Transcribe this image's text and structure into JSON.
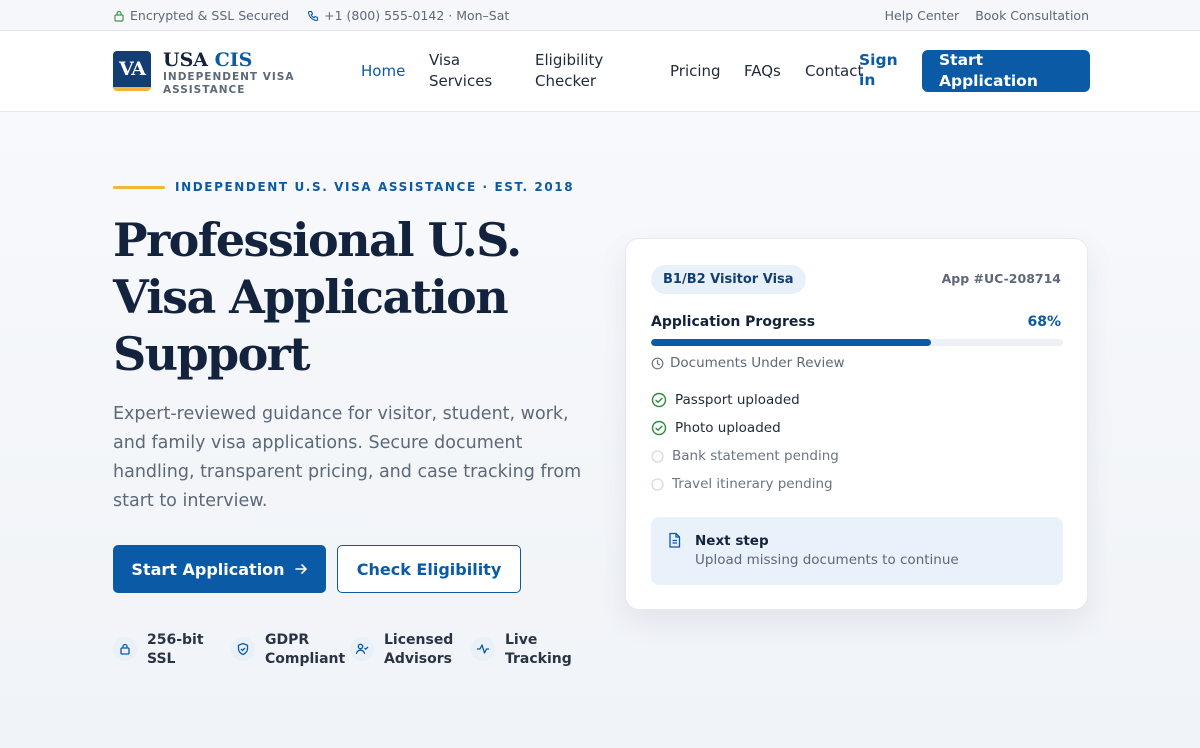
{
  "topbar": {
    "security": "Encrypted & SSL Secured",
    "phone": "+1 (800) 555-0142 · Mon–Sat",
    "help": "Help Center",
    "consult": "Book Consultation"
  },
  "brand": {
    "badge": "VA",
    "name_main": "USA ",
    "name_accent": "CIS",
    "tagline": "INDEPENDENT VISA ASSISTANCE"
  },
  "nav": {
    "items": [
      {
        "label": "Home",
        "active": true
      },
      {
        "label": "Visa Services"
      },
      {
        "label": "Eligibility Checker"
      },
      {
        "label": "Pricing"
      },
      {
        "label": "FAQs"
      },
      {
        "label": "Contact"
      }
    ],
    "signin": "Sign in",
    "cta": "Start Application"
  },
  "hero": {
    "eyebrow": "INDEPENDENT U.S. VISA ASSISTANCE · EST. 2018",
    "title": "Professional U.S. Visa Application Support",
    "lead": "Expert-reviewed guidance for visitor, student, work, and family visa applications. Secure document handling, transparent pricing, and case tracking from start to interview.",
    "primary_btn": "Start Application",
    "secondary_btn": "Check Eligibility",
    "trust": [
      {
        "icon": "lock-icon",
        "label": "256-bit SSL"
      },
      {
        "icon": "shield-icon",
        "label": "GDPR Compliant"
      },
      {
        "icon": "user-check-icon",
        "label": "Licensed Advisors"
      },
      {
        "icon": "activity-icon",
        "label": "Live Tracking"
      }
    ]
  },
  "card": {
    "visa_type": "B1/B2 Visitor Visa",
    "app_number": "App #UC-208714",
    "progress_label": "Application Progress",
    "progress_pct_text": "68%",
    "progress_value": 0.68,
    "status": "Documents Under Review",
    "checklist": [
      {
        "label": "Passport uploaded",
        "done": true
      },
      {
        "label": "Photo uploaded",
        "done": true
      },
      {
        "label": "Bank statement pending",
        "done": false
      },
      {
        "label": "Travel itinerary pending",
        "done": false
      }
    ],
    "next_title": "Next step",
    "next_text": "Upload missing documents to continue"
  },
  "colors": {
    "primary": "#0b5aa6",
    "navy": "#14233d",
    "gold": "#f2b632",
    "success": "#2e8b3d"
  }
}
